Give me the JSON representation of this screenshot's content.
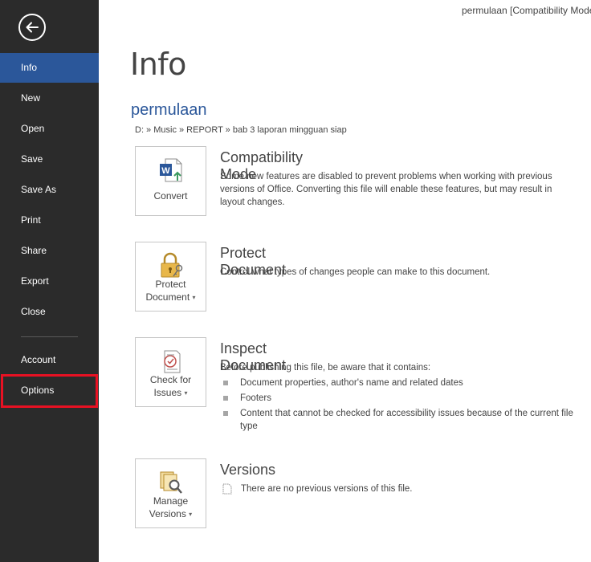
{
  "window": {
    "title": "permulaan [Compatibility Mode]"
  },
  "sidebar": {
    "items": [
      {
        "label": "Info"
      },
      {
        "label": "New"
      },
      {
        "label": "Open"
      },
      {
        "label": "Save"
      },
      {
        "label": "Save As"
      },
      {
        "label": "Print"
      },
      {
        "label": "Share"
      },
      {
        "label": "Export"
      },
      {
        "label": "Close"
      },
      {
        "label": "Account"
      },
      {
        "label": "Options"
      }
    ],
    "active_item": "Info",
    "highlighted_item": "Options"
  },
  "main": {
    "heading": "Info",
    "doc_name": "permulaan",
    "doc_path": "D: » Music » REPORT » bab 3 laporan mingguan siap",
    "sections": {
      "compatibility": {
        "button_label": "Convert",
        "title": "Compatibility Mode",
        "description": "Some new features are disabled to prevent problems when working with previous versions of Office. Converting this file will enable these features, but may result in layout changes."
      },
      "protect": {
        "button_line1": "Protect",
        "button_line2": "Document",
        "title": "Protect Document",
        "description": "Control what types of changes people can make to this document."
      },
      "inspect": {
        "button_line1": "Check for",
        "button_line2": "Issues",
        "title": "Inspect Document",
        "description": "Before publishing this file, be aware that it contains:",
        "bullets": [
          "Document properties, author's name and related dates",
          "Footers",
          "Content that cannot be checked for accessibility issues because of the current file type"
        ]
      },
      "versions": {
        "button_line1": "Manage",
        "button_line2": "Versions",
        "title": "Versions",
        "description": "There are no previous versions of this file."
      }
    }
  },
  "colors": {
    "sidebar_bg": "#2b2b2b",
    "active_item_bg": "#2b579a",
    "accent": "#2b579a",
    "highlight_border": "#e81123"
  }
}
